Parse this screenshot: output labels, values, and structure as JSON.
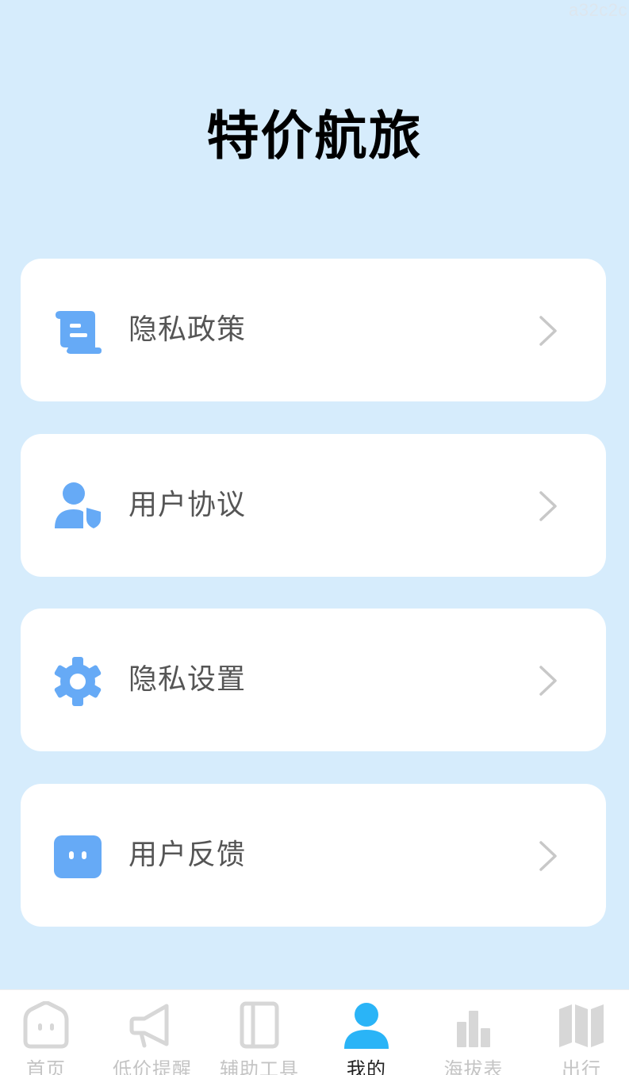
{
  "watermark": "a32c2c",
  "app": {
    "title": "特价航旅"
  },
  "menu": {
    "items": [
      {
        "label": "隐私政策",
        "icon": "scroll-icon"
      },
      {
        "label": "用户协议",
        "icon": "user-shield-icon"
      },
      {
        "label": "隐私设置",
        "icon": "gear-icon"
      },
      {
        "label": "用户反馈",
        "icon": "feedback-icon"
      }
    ]
  },
  "tabbar": {
    "active": 3,
    "tabs": [
      {
        "label": "首页",
        "icon": "home-face-icon"
      },
      {
        "label": "低价提醒",
        "icon": "megaphone-icon"
      },
      {
        "label": "辅助工具",
        "icon": "panel-icon"
      },
      {
        "label": "我的",
        "icon": "person-icon"
      },
      {
        "label": "海拔表",
        "icon": "bar-chart-icon"
      },
      {
        "label": "出行",
        "icon": "map-icon"
      }
    ]
  },
  "colors": {
    "background": "#d6ecfc",
    "icon_blue": "#66aaf6",
    "active_tab": "#2ab4f7",
    "inactive_tab": "#d7d7d7",
    "chevron": "#c8c8c8"
  }
}
